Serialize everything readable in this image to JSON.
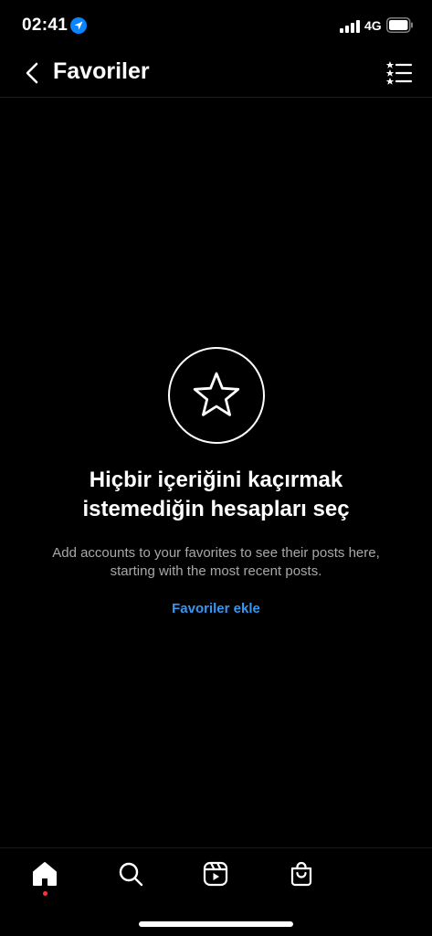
{
  "status_bar": {
    "time": "02:41",
    "network": "4G",
    "icons": [
      "location-arrow-icon",
      "signal-bars-icon",
      "battery-icon"
    ]
  },
  "nav": {
    "title": "Favoriler",
    "back_icon": "chevron-left-icon",
    "menu_icon": "starred-list-icon"
  },
  "empty_state": {
    "icon": "star-icon",
    "heading_line1": "Hiçbir içeriğini kaçırmak",
    "heading_line2": "istemediğin hesapları seç",
    "description_line1": "Add accounts to your favorites to see their posts here,",
    "description_line2": "starting with the most recent posts.",
    "action_label": "Favoriler ekle"
  },
  "tab_bar": {
    "tabs": [
      {
        "icon": "home-icon",
        "active": true,
        "has_notification_dot": true
      },
      {
        "icon": "search-icon",
        "active": false
      },
      {
        "icon": "reels-icon",
        "active": false
      },
      {
        "icon": "shop-bag-icon",
        "active": false
      }
    ]
  },
  "colors": {
    "background": "#000000",
    "text": "#ffffff",
    "secondary_text": "#a8a8a8",
    "link": "#3897f0",
    "notification_dot": "#ff3040",
    "location_icon": "#0a84ff"
  }
}
